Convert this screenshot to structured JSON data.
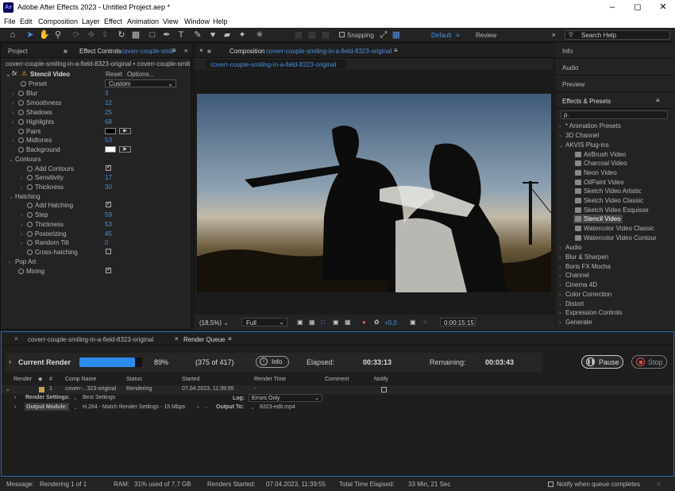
{
  "app": {
    "icon_text": "Ae",
    "title": "Adobe After Effects 2023 - Untitled Project.aep *"
  },
  "menu": [
    "File",
    "Edit",
    "Composition",
    "Layer",
    "Effect",
    "Animation",
    "View",
    "Window",
    "Help"
  ],
  "toolbar": {
    "snapping": "Snapping",
    "workspace_default": "Default",
    "workspace_review": "Review",
    "search_placeholder": "Search Help"
  },
  "left_panel": {
    "tab_project": "Project",
    "tab_effect_controls": "Effect Controls",
    "tab_effect_controls_layer": "coverr-couple-smili",
    "breadcrumb": "coverr-couple-smiling-in-a-field-8323-original • coverr-couple-smiling-i",
    "effect_name": "Stencil Video",
    "reset": "Reset",
    "options": "Options...",
    "preset_label": "Preset",
    "preset_value": "Custom",
    "params": [
      {
        "label": "Blur",
        "value": "3"
      },
      {
        "label": "Smoothness",
        "value": "12"
      },
      {
        "label": "Shadows",
        "value": "25"
      },
      {
        "label": "Highlights",
        "value": "68"
      },
      {
        "label": "Paint",
        "value": ""
      },
      {
        "label": "Midtones",
        "value": "53"
      },
      {
        "label": "Background",
        "value": ""
      }
    ],
    "contours": "Contours",
    "contour_params": [
      {
        "label": "Add Contours",
        "value": ""
      },
      {
        "label": "Sensitivity",
        "value": "17"
      },
      {
        "label": "Thickness",
        "value": "30"
      }
    ],
    "hatching": "Hatching",
    "hatching_params": [
      {
        "label": "Add Hatching",
        "value": ""
      },
      {
        "label": "Step",
        "value": "59"
      },
      {
        "label": "Thickness",
        "value": "53"
      },
      {
        "label": "Posterizing",
        "value": "45"
      },
      {
        "label": "Random Tilt",
        "value": "0"
      },
      {
        "label": "Cross-hatching",
        "value": ""
      }
    ],
    "pop_art": "Pop Art",
    "mixing": "Mixing"
  },
  "composition": {
    "tab_label": "Composition",
    "tab_name": "coverr-couple-smiling-in-a-field-8323-original",
    "sub_tab": "coverr-couple-smiling-in-a-field-8323-original",
    "zoom": "(18,5%)",
    "resolution": "Full",
    "exposure": "+0,0",
    "timecode": "0:00:15:15"
  },
  "right_panel": {
    "info": "Info",
    "audio": "Audio",
    "preview": "Preview",
    "effects_presets": "Effects & Presets",
    "search_prefix": "ρ.",
    "categories_top": [
      "* Animation Presets",
      "3D Channel",
      "AKVIS Plug-ins"
    ],
    "akvis_items": [
      "AirBrush Video",
      "Charcoal Video",
      "Neon Video",
      "OilPaint Video",
      "Sketch Video Artistic",
      "Sketch Video Classic",
      "Sketch Video Esquisse",
      "Stencil Video",
      "Watercolor Video Classic",
      "Watercolor Video Contour"
    ],
    "selected_item": "Stencil Video",
    "categories_bottom": [
      "Audio",
      "Blur & Sharpen",
      "Boris FX Mocha",
      "Channel",
      "Cinema 4D",
      "Color Correction",
      "Distort",
      "Expression Controls",
      "Generate"
    ]
  },
  "render_queue": {
    "tab_comp": "coverr-couple-smiling-in-a-field-8323-original",
    "tab_render_queue": "Render Queue",
    "current_render": "Current Render",
    "progress": 0.89,
    "progress_text": "89%",
    "frames": "(375 of 417)",
    "info_btn": "Info",
    "elapsed_label": "Elapsed:",
    "elapsed_value": "00:33:13",
    "remaining_label": "Remaining:",
    "remaining_value": "00:03:43",
    "pause": "Pause",
    "stop": "Stop",
    "columns": [
      "Render",
      "#",
      "Comp Name",
      "Status",
      "Started",
      "Render Time",
      "Comment",
      "Notify"
    ],
    "item": {
      "num": "1",
      "comp": "coverr-...323-original",
      "status": "Rendering",
      "started": "07.04.2023, 11:39:55",
      "render_time": "-"
    },
    "render_settings_label": "Render Settings:",
    "render_settings_value": "Best Settings",
    "log_label": "Log:",
    "log_value": "Errors Only",
    "output_module_label": "Output Module:",
    "output_module_value": "H.264 - Match Render Settings - 15 Mbps",
    "output_to_label": "Output To:",
    "output_to_value": "8323-edit.mp4"
  },
  "statusbar": {
    "message_label": "Message:",
    "message_value": "Rendering 1 of 1",
    "ram_label": "RAM:",
    "ram_value": "31% used of 7,7 GB",
    "started_label": "Renders Started:",
    "started_value": "07.04.2023, 11:39:55",
    "total_label": "Total Time Elapsed:",
    "total_value": "33 Min, 21 Sec",
    "notify": "Notify when queue completes"
  }
}
